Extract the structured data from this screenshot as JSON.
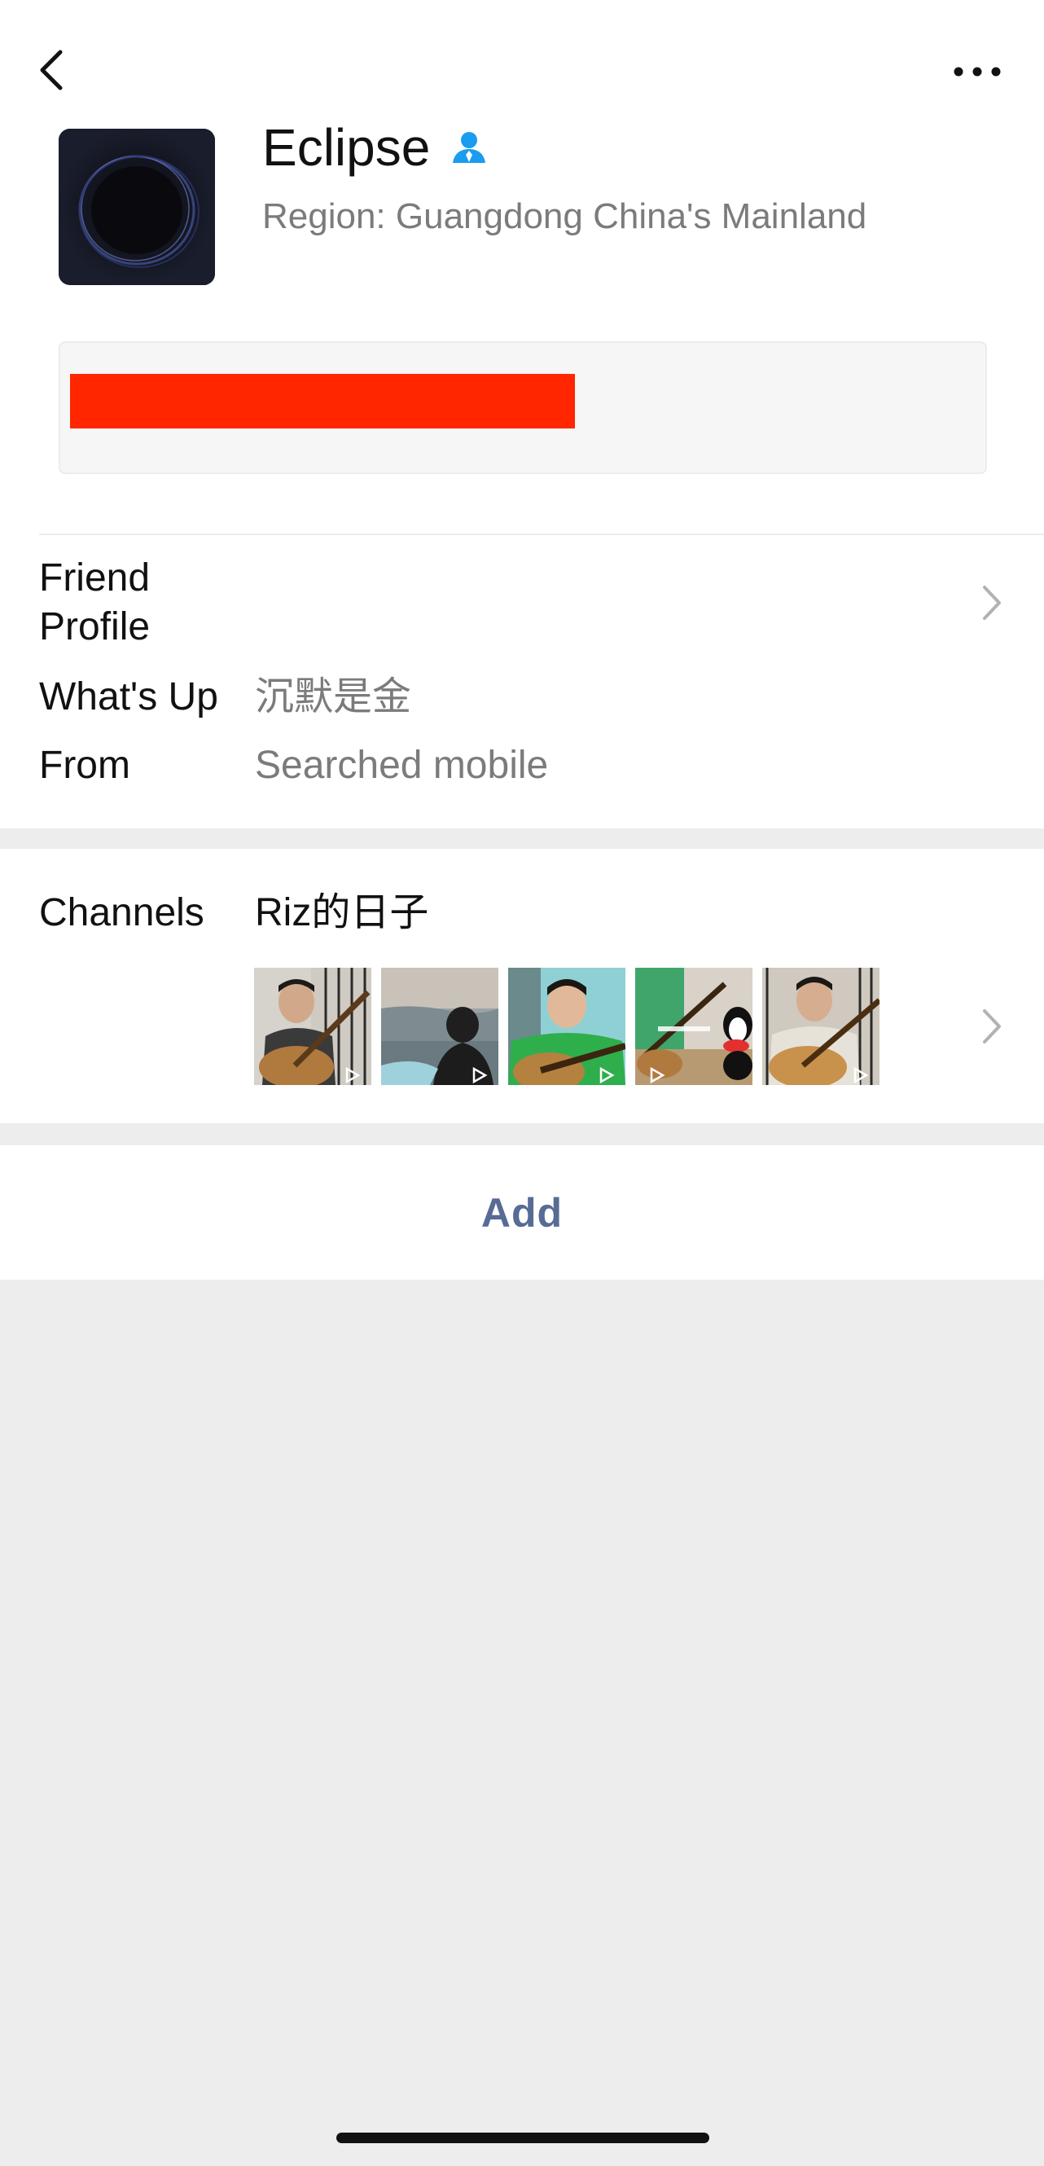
{
  "profile": {
    "name": "Eclipse",
    "region": "Region: Guangdong China's Mainland"
  },
  "rows": {
    "friend_profile_label_line1": "Friend",
    "friend_profile_label_line2": "Profile",
    "whats_up_label": "What's Up",
    "whats_up_value": "沉默是金",
    "from_label": "From",
    "from_value": "Searched mobile"
  },
  "channels": {
    "label": "Channels",
    "name": "Riz的日子",
    "thumbnail_count": 5
  },
  "actions": {
    "add_label": "Add"
  },
  "colors": {
    "link": "#576b95",
    "verified_icon": "#1a9cf0",
    "redaction": "#ff2600",
    "background": "#ededed"
  },
  "icons": [
    "back-arrow-icon",
    "more-dots-icon",
    "verified-contact-icon",
    "chevron-right-icon",
    "play-icon"
  ]
}
